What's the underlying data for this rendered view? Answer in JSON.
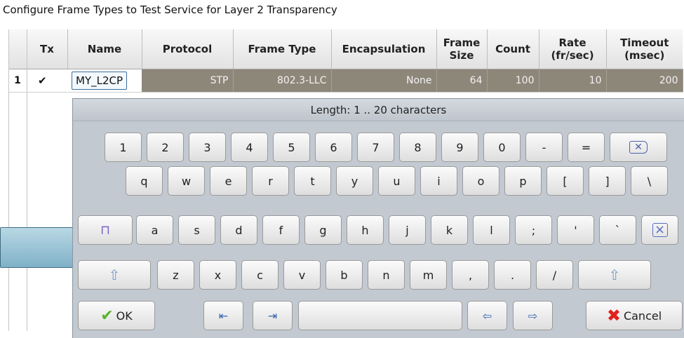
{
  "title": "Configure Frame Types to Test Service for Layer 2 Transparency",
  "columns": [
    "",
    "Tx",
    "Name",
    "Protocol",
    "Frame Type",
    "Encapsulation",
    "Frame Size",
    "Count",
    "Rate (fr/sec)",
    "Timeout (msec)"
  ],
  "row": {
    "index": "1",
    "tx_checked": "✔",
    "name": "MY_L2CP",
    "protocol": "STP",
    "frame_type": "802.3-LLC",
    "encapsulation": "None",
    "frame_size": "64",
    "count": "100",
    "rate": "10",
    "timeout": "200"
  },
  "keyboard": {
    "hint": "Length:  1 .. 20 characters",
    "row1": [
      "1",
      "2",
      "3",
      "4",
      "5",
      "6",
      "7",
      "8",
      "9",
      "0",
      "-",
      "="
    ],
    "row2": [
      "q",
      "w",
      "e",
      "r",
      "t",
      "y",
      "u",
      "i",
      "o",
      "p",
      "[",
      "]",
      "\\"
    ],
    "row3": [
      "a",
      "s",
      "d",
      "f",
      "g",
      "h",
      "j",
      "k",
      "l",
      ";",
      "'",
      "`"
    ],
    "row4": [
      "z",
      "x",
      "c",
      "v",
      "b",
      "n",
      "m",
      ",",
      ".",
      "/"
    ],
    "ok_label": "OK",
    "cancel_label": "Cancel",
    "icons": {
      "backspace": "backspace-icon",
      "caps_lock": "lock-icon",
      "clear": "clear-icon",
      "shift": "shift-icon",
      "home": "jump-start-icon",
      "end": "jump-end-icon",
      "left": "arrow-left-icon",
      "right": "arrow-right-icon",
      "ok": "checkmark-icon",
      "cancel": "red-x-icon"
    }
  }
}
